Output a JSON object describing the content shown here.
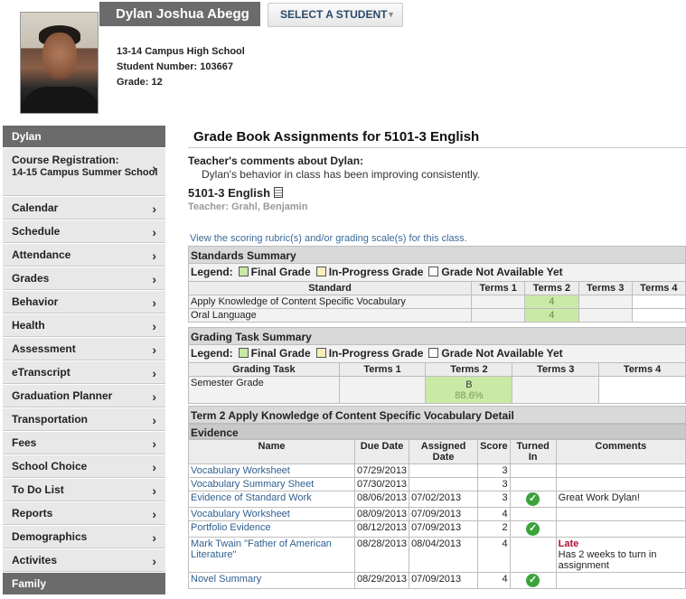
{
  "student": {
    "name": "Dylan Joshua Abegg",
    "select_label": "SELECT A STUDENT",
    "school": "13-14 Campus High School",
    "number": "Student Number: 103667",
    "grade": "Grade: 12"
  },
  "sidebar": {
    "header": "Dylan",
    "course_reg": {
      "label": "Course Registration:",
      "sub": "14-15 Campus Summer School"
    },
    "items": [
      {
        "label": "Calendar"
      },
      {
        "label": "Schedule"
      },
      {
        "label": "Attendance"
      },
      {
        "label": "Grades"
      },
      {
        "label": "Behavior"
      },
      {
        "label": "Health"
      },
      {
        "label": "Assessment"
      },
      {
        "label": "eTranscript"
      },
      {
        "label": "Graduation Planner"
      },
      {
        "label": "Transportation"
      },
      {
        "label": "Fees"
      },
      {
        "label": "School Choice"
      },
      {
        "label": "To Do List"
      },
      {
        "label": "Reports"
      },
      {
        "label": "Demographics"
      },
      {
        "label": "Activites"
      }
    ],
    "footer": "Family",
    "chevron": "›"
  },
  "main": {
    "title": "Grade Book Assignments for 5101-3 English",
    "teacher_comments_label": "Teacher's comments about Dylan:",
    "teacher_comments": "Dylan's behavior in class has been improving consistently.",
    "course": "5101-3 English",
    "teacher": "Teacher: Grahl, Benjamin",
    "rubric_link": "View the scoring rubric(s) and/or grading scale(s) for this class.",
    "legend": {
      "label": "Legend:",
      "final": "Final Grade",
      "progress": "In-Progress Grade",
      "na": "Grade Not Available Yet"
    },
    "standards": {
      "title": "Standards Summary",
      "headers": [
        "Standard",
        "Terms 1",
        "Terms 2",
        "Terms 3",
        "Terms 4"
      ],
      "rows": [
        {
          "name": "Apply Knowledge of Content Specific Vocabulary",
          "t2": "4"
        },
        {
          "name": "Oral Language",
          "t2": "4"
        }
      ]
    },
    "tasks": {
      "title": "Grading Task Summary",
      "headers": [
        "Grading Task",
        "Terms 1",
        "Terms 2",
        "Terms 3",
        "Terms 4"
      ],
      "row": {
        "name": "Semester Grade",
        "t2_grade": "B",
        "t2_pct": "88.6%"
      }
    },
    "detail_title": "Term 2 Apply Knowledge of Content Specific Vocabulary Detail",
    "evidence": {
      "title": "Evidence",
      "headers": [
        "Name",
        "Due Date",
        "Assigned Date",
        "Score",
        "Turned In",
        "Comments"
      ],
      "rows": [
        {
          "name": "Vocabulary Worksheet",
          "due": "07/29/2013",
          "assigned": "",
          "score": "3",
          "turned": false,
          "comment": ""
        },
        {
          "name": "Vocabulary Summary Sheet",
          "due": "07/30/2013",
          "assigned": "",
          "score": "3",
          "turned": false,
          "comment": ""
        },
        {
          "name": "Evidence of Standard Work",
          "due": "08/06/2013",
          "assigned": "07/02/2013",
          "score": "3",
          "turned": true,
          "comment": "Great Work Dylan!"
        },
        {
          "name": "Vocabulary Worksheet",
          "due": "08/09/2013",
          "assigned": "07/09/2013",
          "score": "4",
          "turned": false,
          "comment": ""
        },
        {
          "name": "Portfolio Evidence",
          "due": "08/12/2013",
          "assigned": "07/09/2013",
          "score": "2",
          "turned": true,
          "comment": ""
        },
        {
          "name": "Mark Twain \"Father of American Literature\"",
          "due": "08/28/2013",
          "assigned": "08/04/2013",
          "score": "4",
          "turned": false,
          "late": "Late",
          "comment": "Has 2 weeks to turn in assignment"
        },
        {
          "name": "Novel Summary",
          "due": "08/29/2013",
          "assigned": "07/09/2013",
          "score": "4",
          "turned": true,
          "comment": ""
        }
      ],
      "check": "✓"
    },
    "colors": {
      "final": "#c9eaa7",
      "progress": "#f5f0b8"
    }
  }
}
